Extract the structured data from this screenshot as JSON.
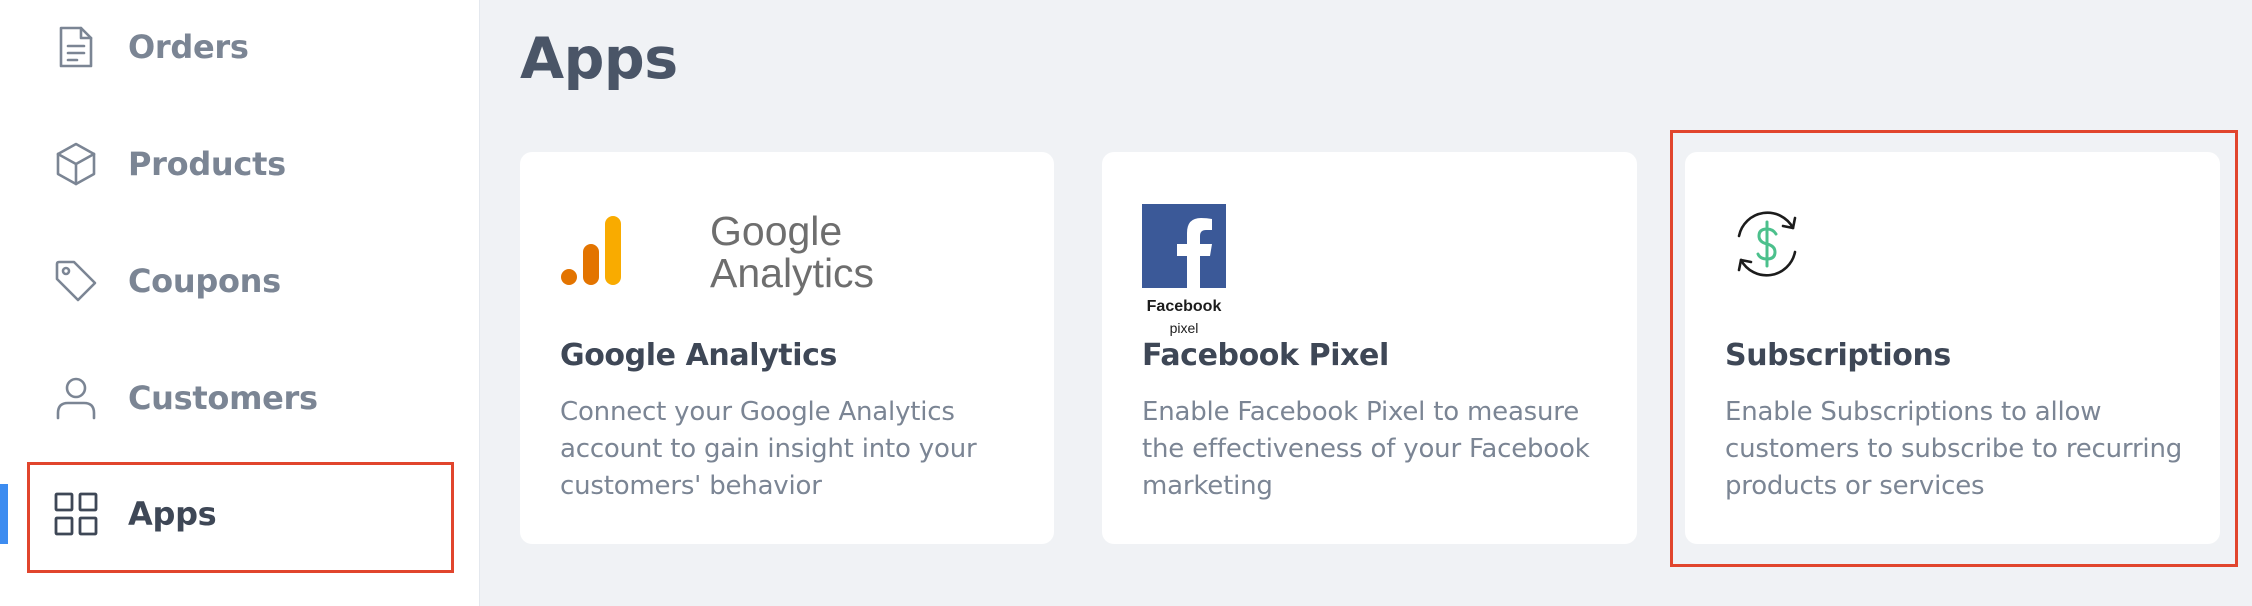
{
  "sidebar": {
    "items": [
      {
        "label": "Orders",
        "icon": "document-icon"
      },
      {
        "label": "Products",
        "icon": "box-icon"
      },
      {
        "label": "Coupons",
        "icon": "tag-icon"
      },
      {
        "label": "Customers",
        "icon": "user-icon"
      },
      {
        "label": "Apps",
        "icon": "grid-icon",
        "active": true
      }
    ]
  },
  "main": {
    "title": "Apps",
    "apps": [
      {
        "name": "Google Analytics",
        "description": [
          "Connect your Google Analytics",
          "account to gain insight into your",
          "customers' behavior"
        ],
        "logo": {
          "line1": "Google",
          "line2": "Analytics"
        }
      },
      {
        "name": "Facebook Pixel",
        "description": [
          "Enable Facebook Pixel to measure",
          "the effectiveness of your Facebook",
          "marketing"
        ],
        "logo": {
          "line1": "Facebook",
          "line2": "pixel"
        }
      },
      {
        "name": "Subscriptions",
        "description": [
          "Enable Subscriptions to allow",
          "customers to subscribe to recurring",
          "products or services"
        ]
      }
    ]
  },
  "colors": {
    "accent": "#3d8cf0",
    "highlight": "#e1452d",
    "text_dark": "#3e4756",
    "text_muted": "#7b8594",
    "background": "#f0f2f5",
    "facebook_blue": "#3b5998",
    "subscriptions_green": "#4cc08c"
  }
}
